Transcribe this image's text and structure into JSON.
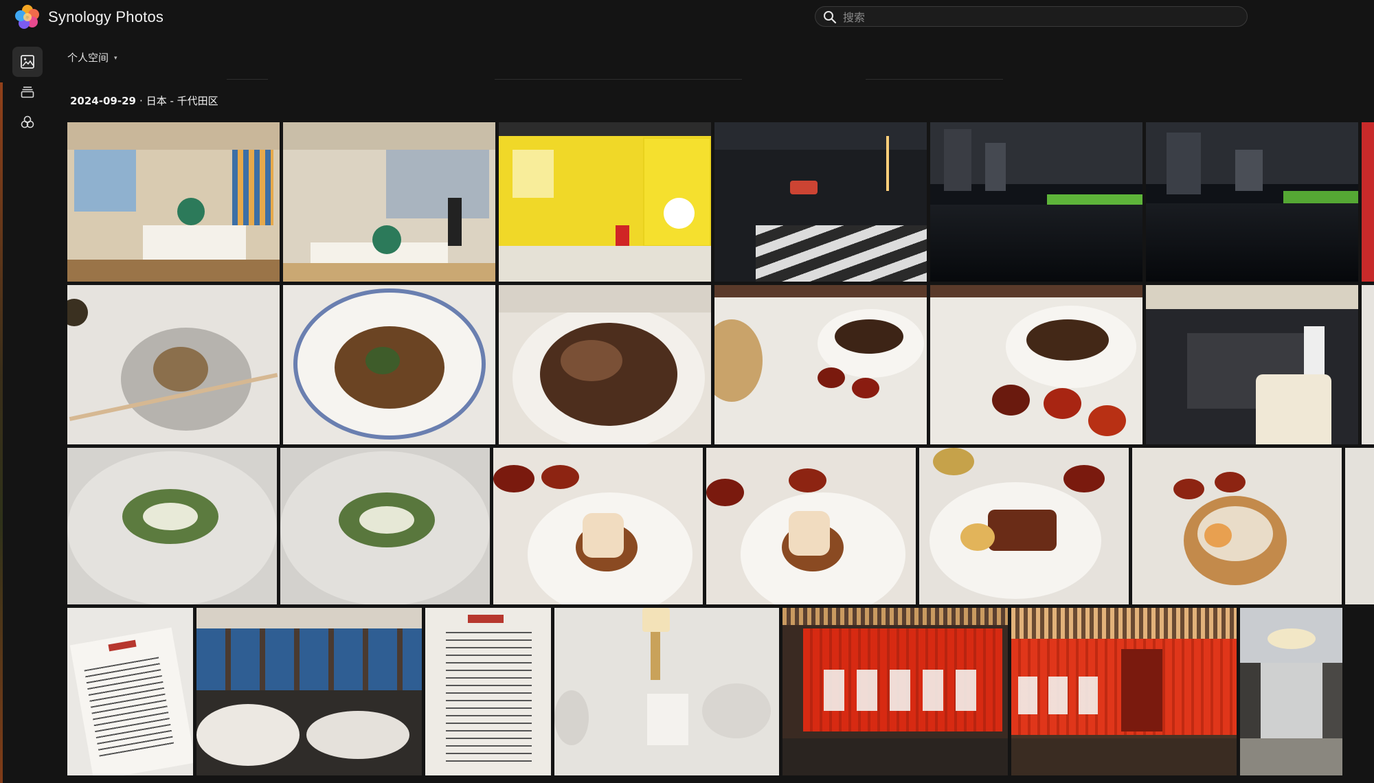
{
  "app": {
    "title": "Synology Photos"
  },
  "search": {
    "placeholder": "搜索"
  },
  "nav": {
    "items": [
      {
        "name": "photos",
        "icon": "photo-icon",
        "active": true
      },
      {
        "name": "albums",
        "icon": "album-stack-icon",
        "active": false
      },
      {
        "name": "shared",
        "icon": "shared-space-icon",
        "active": false
      }
    ]
  },
  "space_selector": {
    "label": "个人空间",
    "caret": "▾"
  },
  "section": {
    "date": "2024-09-29",
    "separator": "·",
    "location": "日本 - 千代田区"
  },
  "photos": {
    "row1": [
      {
        "subject": "shop-interior",
        "colors": [
          "#e9ddc7",
          "#8a6a3e"
        ]
      },
      {
        "subject": "shop-interior",
        "colors": [
          "#e3dccd",
          "#9c7d4c"
        ]
      },
      {
        "subject": "peanuts-poster",
        "colors": [
          "#f2dc2a",
          "#e7e2d2"
        ]
      },
      {
        "subject": "night-crosswalk",
        "colors": [
          "#1d1f22",
          "#d7d7d7"
        ]
      },
      {
        "subject": "night-moat",
        "colors": [
          "#0f1218",
          "#3b4d2a"
        ]
      },
      {
        "subject": "night-moat",
        "colors": [
          "#0e1116",
          "#324523"
        ]
      }
    ],
    "row2": [
      {
        "subject": "fried-rice",
        "colors": [
          "#ece9e3",
          "#8b6f4c"
        ]
      },
      {
        "subject": "noodle-bowl",
        "colors": [
          "#f3f0ea",
          "#6b4423"
        ]
      },
      {
        "subject": "roast-duck",
        "colors": [
          "#ebe6df",
          "#4d2e1d"
        ]
      },
      {
        "subject": "duck-plate",
        "colors": [
          "#efece6",
          "#3d2416"
        ]
      },
      {
        "subject": "duck-plate",
        "colors": [
          "#efebe5",
          "#432817"
        ]
      },
      {
        "subject": "restaurant-interior",
        "colors": [
          "#2a2b30",
          "#d9d2c2"
        ]
      }
    ],
    "row3": [
      {
        "subject": "bok-choy",
        "colors": [
          "#dcdad6",
          "#5c7b3f"
        ]
      },
      {
        "subject": "bok-choy",
        "colors": [
          "#d9d7d3",
          "#59773d"
        ]
      },
      {
        "subject": "spring-roll",
        "colors": [
          "#ece7e0",
          "#8a4a22"
        ]
      },
      {
        "subject": "spring-roll",
        "colors": [
          "#ebe6df",
          "#8a4a22"
        ]
      },
      {
        "subject": "char-siu",
        "colors": [
          "#e8e5df",
          "#6a2c17"
        ]
      },
      {
        "subject": "dim-sum-basket",
        "colors": [
          "#e9e5de",
          "#c38a4b"
        ]
      }
    ],
    "row4": [
      {
        "subject": "menu-card",
        "colors": [
          "#f0ede8",
          "#b7372e"
        ]
      },
      {
        "subject": "dining-room",
        "colors": [
          "#2f2c29",
          "#3e74a8"
        ]
      },
      {
        "subject": "menu-card",
        "colors": [
          "#efece6",
          "#333"
        ]
      },
      {
        "subject": "table-setting",
        "colors": [
          "#e7e5e0",
          "#c9a25a"
        ]
      },
      {
        "subject": "red-facade",
        "colors": [
          "#d72a12",
          "#3a2a22"
        ]
      },
      {
        "subject": "red-facade",
        "colors": [
          "#e0361a",
          "#4a3224"
        ]
      },
      {
        "subject": "corridor",
        "colors": [
          "#cfd0d0",
          "#5c5a55"
        ]
      }
    ]
  }
}
